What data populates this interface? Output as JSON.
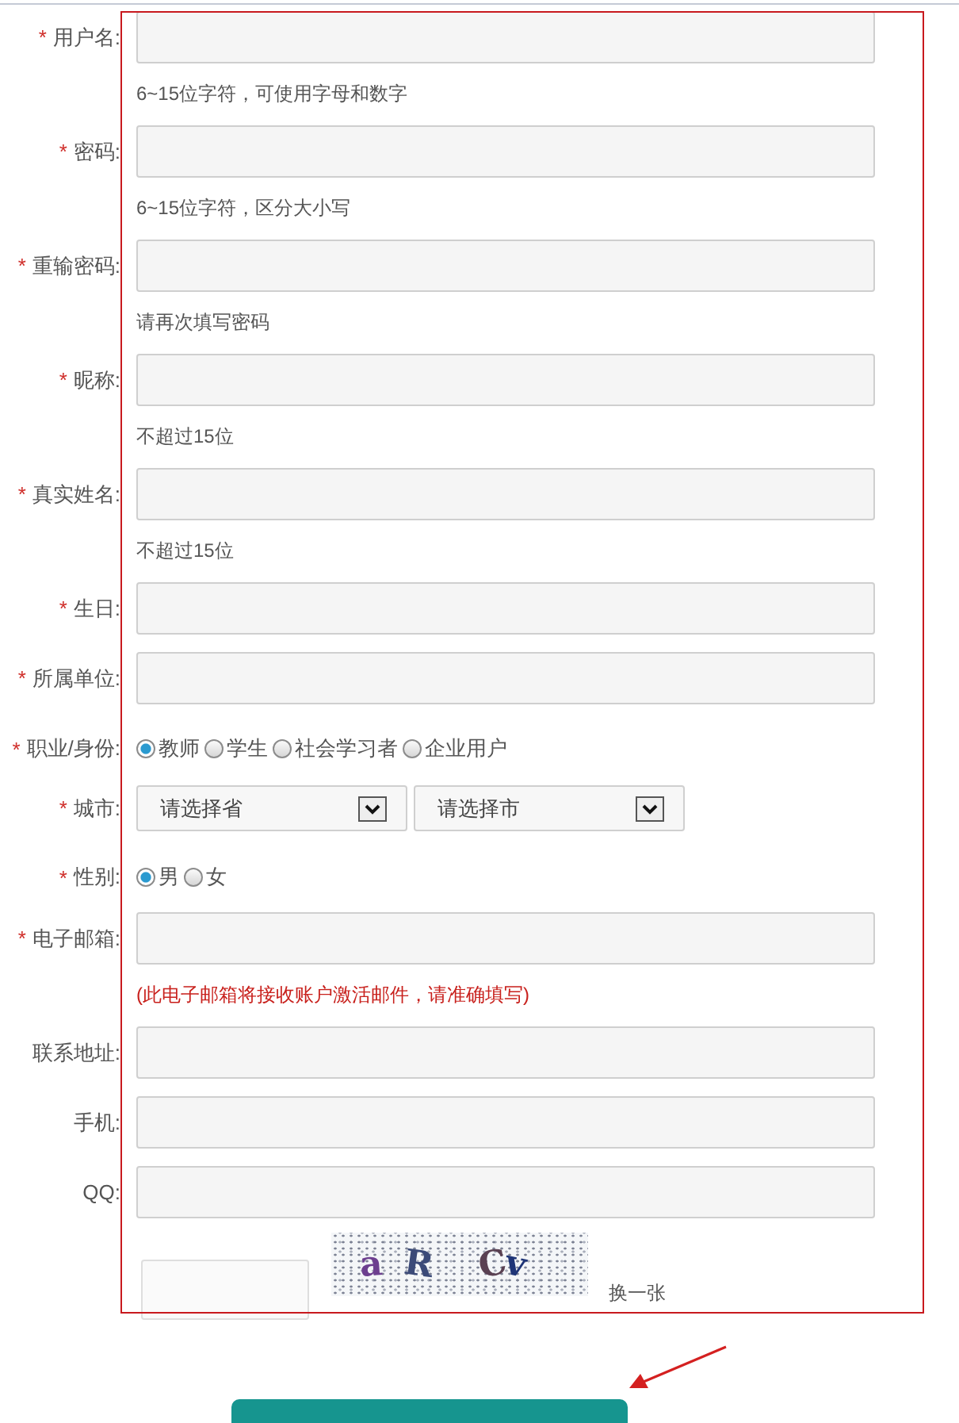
{
  "form": {
    "fields": [
      {
        "kind": "input",
        "required_mark": "*",
        "label": "用户名:",
        "hint": "6~15位字符，可使用字母和数字"
      },
      {
        "kind": "input",
        "required_mark": "*",
        "label": "密码:",
        "hint": "6~15位字符，区分大小写"
      },
      {
        "kind": "input",
        "required_mark": "*",
        "label": "重输密码:",
        "hint": "请再次填写密码"
      },
      {
        "kind": "input",
        "required_mark": "*",
        "label": "昵称:",
        "hint": "不超过15位"
      },
      {
        "kind": "input",
        "required_mark": "*",
        "label": "真实姓名:",
        "hint": "不超过15位"
      },
      {
        "kind": "input",
        "required_mark": "*",
        "label": "生日:"
      },
      {
        "kind": "input",
        "required_mark": "*",
        "label": "所属单位:"
      },
      {
        "kind": "radio",
        "required_mark": "*",
        "label": "职业/身份:",
        "options": [
          {
            "label": "教师",
            "selected": true
          },
          {
            "label": "学生",
            "selected": false
          },
          {
            "label": "社会学习者",
            "selected": false
          },
          {
            "label": "企业用户",
            "selected": false
          }
        ]
      },
      {
        "kind": "select",
        "required_mark": "*",
        "label": "城市:",
        "selects": [
          {
            "placeholder": "请选择省"
          },
          {
            "placeholder": "请选择市"
          }
        ]
      },
      {
        "kind": "radio",
        "required_mark": "*",
        "label": "性别:",
        "options": [
          {
            "label": "男",
            "selected": true
          },
          {
            "label": "女",
            "selected": false
          }
        ]
      },
      {
        "kind": "input",
        "required_mark": "*",
        "label": "电子邮箱:",
        "warning": "(此电子邮箱将接收账户激活邮件，请准确填写)"
      },
      {
        "kind": "input",
        "label": "联系地址:"
      },
      {
        "kind": "input",
        "label": "手机:"
      },
      {
        "kind": "input",
        "label": "QQ:"
      }
    ]
  },
  "captcha": {
    "code": "a R Cv",
    "refresh_label": "换一张"
  }
}
